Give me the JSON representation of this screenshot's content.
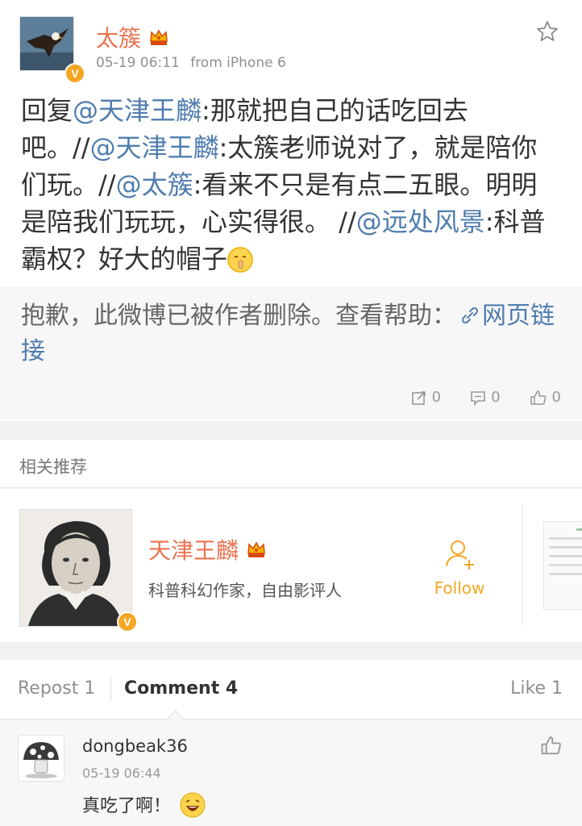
{
  "post": {
    "author_name": "太簇",
    "timestamp": "05-19 06:11",
    "source": "from iPhone 6",
    "verified_badge": "V",
    "body_segments": [
      {
        "text": "回复",
        "type": "plain"
      },
      {
        "text": "@天津王麟",
        "type": "mention"
      },
      {
        "text": ":那就把自己的话吃回去吧。//",
        "type": "plain"
      },
      {
        "text": "@天津王麟",
        "type": "mention"
      },
      {
        "text": ":太簇老师说对了，就是陪你们玩。//",
        "type": "plain"
      },
      {
        "text": "@太簇",
        "type": "mention"
      },
      {
        "text": ":看来不只是有点二五眼。明明是陪我们玩玩，心实得很。 //",
        "type": "plain"
      },
      {
        "text": "@远处风景",
        "type": "mention"
      },
      {
        "text": ":科普霸权？好大的帽子",
        "type": "plain"
      }
    ],
    "emoji_name": "shush-emoji",
    "repost_deleted_text": "抱歉，此微博已被作者删除。查看帮助：",
    "repost_link_text": "网页链接",
    "repost_count": "0",
    "comment_count": "0",
    "like_count": "0"
  },
  "related": {
    "header": "相关推荐",
    "user_name": "天津王麟",
    "user_desc": "科普科幻作家，自由影评人",
    "follow_label": "Follow",
    "verified_badge": "V"
  },
  "tabs": {
    "repost": "Repost 1",
    "comment": "Comment 4",
    "like": "Like 1"
  },
  "comment": {
    "user": "dongbeak36",
    "time": "05-19 06:44",
    "text": "真吃了啊！",
    "emoji_name": "laughing-emoji"
  },
  "colors": {
    "accent_orange": "#eb7350",
    "link_blue": "#507daf",
    "badge_gold": "#f5a623"
  }
}
